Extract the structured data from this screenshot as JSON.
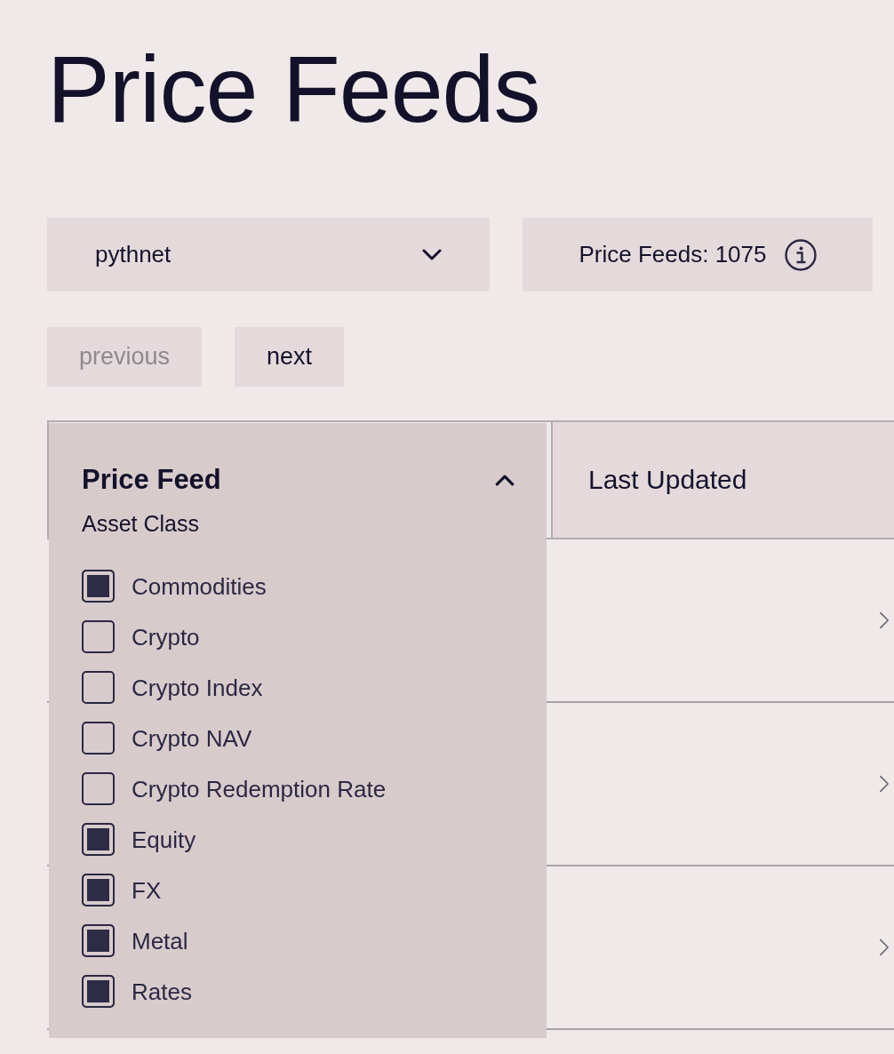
{
  "page_title": "Price Feeds",
  "network_select": {
    "value": "pythnet"
  },
  "feed_count": {
    "text": "Price Feeds: 1075"
  },
  "pagination": [
    {
      "label": "previous",
      "disabled": true
    },
    {
      "label": "next",
      "disabled": false
    }
  ],
  "table": {
    "columns": [
      {
        "label": "Price Feed",
        "kind": "menu",
        "expanded": true
      },
      {
        "label": "Last Updated",
        "kind": "plain"
      }
    ],
    "asset_class_filter": {
      "title": "Asset Class",
      "options": [
        {
          "label": "Commodities",
          "checked": true
        },
        {
          "label": "Crypto",
          "checked": false
        },
        {
          "label": "Crypto Index",
          "checked": false
        },
        {
          "label": "Crypto NAV",
          "checked": false
        },
        {
          "label": "Crypto Redemption Rate",
          "checked": false
        },
        {
          "label": "Equity",
          "checked": true
        },
        {
          "label": "FX",
          "checked": true
        },
        {
          "label": "Metal",
          "checked": true
        },
        {
          "label": "Rates",
          "checked": true
        }
      ]
    },
    "rows": [
      {
        "expanded": false
      },
      {
        "expanded": false
      },
      {
        "expanded": false
      }
    ]
  }
}
